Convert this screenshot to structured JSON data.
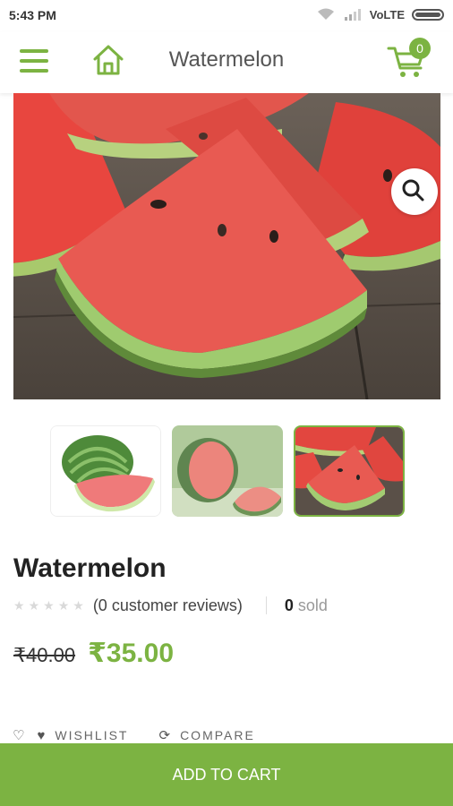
{
  "status_bar": {
    "time": "5:43 PM",
    "carrier": "VoLTE"
  },
  "header": {
    "title": "Watermelon",
    "cart_count": "0",
    "icons": {
      "menu": "hamburger-icon",
      "home": "home-icon",
      "cart": "cart-icon"
    }
  },
  "gallery": {
    "zoom_icon": "magnifier-icon",
    "thumbnails": [
      "whole-watermelon",
      "watermelon-halves",
      "watermelon-slices"
    ],
    "selected_index": 2
  },
  "product": {
    "name": "Watermelon",
    "rating": 0,
    "reviews_text": "(0 customer reviews)",
    "sold_count": "0",
    "sold_label": "sold",
    "old_price": "₹40.00",
    "price": "₹35.00"
  },
  "actions": {
    "wishlist_label": "WISHLIST",
    "compare_label": "COMPARE",
    "add_to_cart_label": "ADD TO CART"
  },
  "colors": {
    "accent": "#7cb342",
    "title_gray": "#555555",
    "star_empty": "#d9d9d9"
  }
}
